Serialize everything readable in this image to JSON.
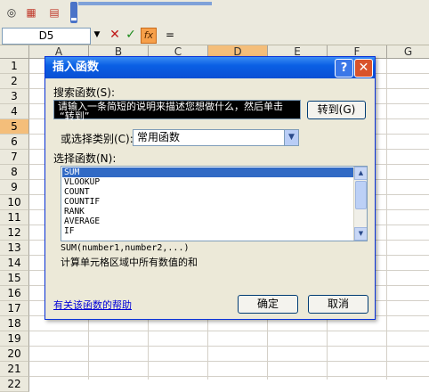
{
  "toolbar": {
    "icons": [
      "wizard-icon",
      "chart-icon",
      "pdf-icon"
    ]
  },
  "formula_bar": {
    "name_box": "D5",
    "content": "=",
    "fx_label": "fx"
  },
  "grid": {
    "columns": [
      "A",
      "B",
      "C",
      "D",
      "E",
      "F",
      "G"
    ],
    "selected_column": "D",
    "rows": [
      "1",
      "2",
      "3",
      "4",
      "5",
      "6",
      "7",
      "8",
      "9",
      "10",
      "11",
      "12",
      "13",
      "14",
      "15",
      "16",
      "17",
      "18",
      "19",
      "20",
      "21",
      "22"
    ],
    "selected_row": "5"
  },
  "dialog": {
    "title": "插入函数",
    "help_button": "?",
    "close_button": "✕",
    "search_label": "搜索函数(S):",
    "search_text_line1": "请输入一条简短的说明来描述您想做什么，然后单击",
    "search_text_line2": "“转到”",
    "goto_button": "转到(G)",
    "category_label": "或选择类别(C):",
    "category_value": "常用函数",
    "list_label": "选择函数(N):",
    "functions": [
      "SUM",
      "VLOOKUP",
      "COUNT",
      "COUNTIF",
      "RANK",
      "AVERAGE",
      "IF"
    ],
    "selected_function": "SUM",
    "syntax": "SUM(number1,number2,...)",
    "description": "计算单元格区域中所有数值的和",
    "help_link": "有关该函数的帮助",
    "ok_button": "确定",
    "cancel_button": "取消"
  }
}
